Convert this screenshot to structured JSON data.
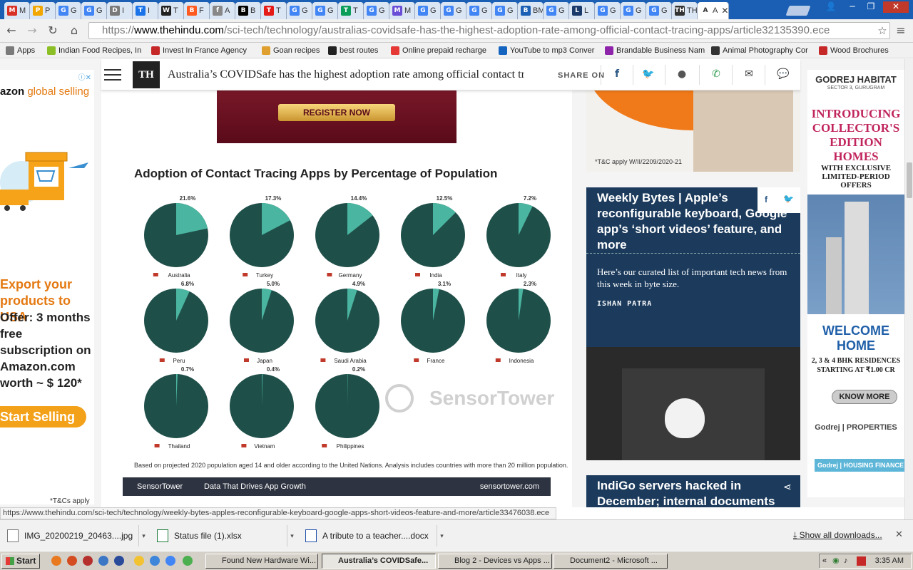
{
  "tabs": [
    {
      "fav": "M",
      "color": "#d93025",
      "title": "M"
    },
    {
      "fav": "P",
      "color": "#f2a600",
      "title": "P"
    },
    {
      "fav": "G",
      "color": "#4285f4",
      "title": "G"
    },
    {
      "fav": "G",
      "color": "#4285f4",
      "title": "G"
    },
    {
      "fav": "D",
      "color": "#7a7a7a",
      "title": "I"
    },
    {
      "fav": "T",
      "color": "#1a73e8",
      "title": "I"
    },
    {
      "fav": "W",
      "color": "#222222",
      "title": "T"
    },
    {
      "fav": "B",
      "color": "#ff5a1f",
      "title": "F"
    },
    {
      "fav": "f",
      "color": "#888888",
      "title": "A"
    },
    {
      "fav": "B",
      "color": "#000000",
      "title": "B"
    },
    {
      "fav": "T",
      "color": "#e41b17",
      "title": "T"
    },
    {
      "fav": "G",
      "color": "#4285f4",
      "title": "G"
    },
    {
      "fav": "G",
      "color": "#4285f4",
      "title": "G"
    },
    {
      "fav": "T",
      "color": "#0a9e5a",
      "title": "T"
    },
    {
      "fav": "G",
      "color": "#4285f4",
      "title": "G"
    },
    {
      "fav": "M",
      "color": "#6a4fd6",
      "title": "M"
    },
    {
      "fav": "G",
      "color": "#4285f4",
      "title": "G"
    },
    {
      "fav": "G",
      "color": "#4285f4",
      "title": "G"
    },
    {
      "fav": "G",
      "color": "#4285f4",
      "title": "G"
    },
    {
      "fav": "G",
      "color": "#4285f4",
      "title": "G"
    },
    {
      "fav": "B",
      "color": "#1a5fb4",
      "title": "BMJ"
    },
    {
      "fav": "G",
      "color": "#4285f4",
      "title": "G"
    },
    {
      "fav": "L",
      "color": "#1a3a6c",
      "title": "L"
    },
    {
      "fav": "G",
      "color": "#4285f4",
      "title": "G"
    },
    {
      "fav": "G",
      "color": "#4285f4",
      "title": "G"
    },
    {
      "fav": "G",
      "color": "#4285f4",
      "title": "G"
    },
    {
      "fav": "TH",
      "color": "#333333",
      "title": "TH"
    },
    {
      "fav": "A",
      "color": "#ffffff",
      "title": "A",
      "active": true
    }
  ],
  "url": {
    "scheme": "https://",
    "domain": "www.thehindu.com",
    "path": "/sci-tech/technology/australias-covidsafe-has-the-highest-adoption-rate-among-official-contact-tracing-apps/article32135390.ece"
  },
  "bookmarks": [
    {
      "label": "Apps",
      "color": "#7a7a7a"
    },
    {
      "label": "Indian Food Recipes, In",
      "color": "#8cbf26"
    },
    {
      "label": "Invest In France Agency",
      "color": "#c62828"
    },
    {
      "label": "Goan recipes",
      "color": "#e0a030"
    },
    {
      "label": "best routes",
      "color": "#222"
    },
    {
      "label": "Online prepaid recharge",
      "color": "#e53935"
    },
    {
      "label": "YouTube to mp3 Conver",
      "color": "#1565c0"
    },
    {
      "label": "Brandable Business Nam",
      "color": "#8e24aa"
    },
    {
      "label": "Animal Photography Cor",
      "color": "#333"
    },
    {
      "label": "Wood Brochures",
      "color": "#c62828"
    }
  ],
  "sticky": {
    "logo": "TH",
    "title": "Australia’s COVIDSafe has the highest adoption rate among official contact tracing apps",
    "share_label": "SHARE ON"
  },
  "left_ad": {
    "logo_prefix": "azon",
    "logo_suffix": "global selling",
    "headline": "Export your products to USA",
    "offer": "Offer: 3 months free subscription on Amazon.com worth ~ $ 120*",
    "cta": "Start Selling",
    "tnc": "*T&Cs apply"
  },
  "banner": {
    "button": "REGISTER NOW"
  },
  "chart_data": {
    "type": "pie",
    "title": "Adoption of Contact Tracing Apps by Percentage of Population",
    "categories": [
      "Australia",
      "Turkey",
      "Germany",
      "India",
      "Italy",
      "Peru",
      "Japan",
      "Saudi Arabia",
      "France",
      "Indonesia",
      "Thailand",
      "Vietnam",
      "Philippines"
    ],
    "values": [
      21.6,
      17.3,
      14.4,
      12.5,
      7.2,
      6.8,
      5.0,
      4.9,
      3.1,
      2.3,
      0.7,
      0.4,
      0.2
    ],
    "labels": [
      "21.6%",
      "17.3%",
      "14.4%",
      "12.5%",
      "7.2%",
      "6.8%",
      "5.0%",
      "4.9%",
      "3.1%",
      "2.3%",
      "0.7%",
      "0.4%",
      "0.2%"
    ],
    "colors": {
      "adopted": "#4ab5a0",
      "rest": "#1f4f49"
    },
    "watermark": "SensorTower",
    "footnote": "Based on projected 2020 population aged 14 and older according to the United Nations. Analysis includes countries with more than 20 million population."
  },
  "sensortower_bar": {
    "brand": "SensorTower",
    "tagline": "Data That Drives App Growth",
    "site": "sensortower.com"
  },
  "right_top_ad": {
    "tnc": "*T&C apply W/II/2209/2020-21"
  },
  "card1": {
    "title": "Weekly Bytes | Apple’s reconfigurable keyboard, Google app’s ‘short videos’ feature, and more",
    "desc": "Here’s our curated list of important tech news from this week in byte size.",
    "author": "ISHAN PATRA"
  },
  "card2": {
    "title": "IndiGo servers hacked in December; internal documents may get uploaded publicly"
  },
  "far_ad": {
    "brand": "GODREJ HABITAT",
    "location": "SECTOR 3, GURUGRAM",
    "headline": "INTRODUCING COLLECTOR'S EDITION HOMES",
    "sub": "WITH EXCLUSIVE LIMITED-PERIOD OFFERS",
    "welcome": "WELCOME HOME",
    "bhk": "2, 3 & 4 BHK RESIDENCES STARTING AT ₹1.00 CR",
    "cta": "KNOW MORE",
    "godrej1": "Godrej | PROPERTIES",
    "godrej2": "Godrej | HOUSING FINANCE"
  },
  "status_url": "https://www.thehindu.com/sci-tech/technology/weekly-bytes-apples-reconfigurable-keyboard-google-apps-short-videos-feature-and-more/article33476038.ece",
  "downloads": [
    {
      "name": "IMG_20200219_20463....jpg"
    },
    {
      "name": "Status file (1).xlsx"
    },
    {
      "name": "A tribute to a teacher....docx"
    }
  ],
  "show_all_downloads": "Show all downloads...",
  "taskbar": {
    "start": "Start",
    "items": [
      {
        "label": "Found New Hardware Wi...",
        "active": false
      },
      {
        "label": "Australia’s COVIDSafe...",
        "active": true
      },
      {
        "label": "Blog 2 - Devices vs Apps ...",
        "active": false
      },
      {
        "label": "Document2 - Microsoft ...",
        "active": false
      }
    ],
    "clock": "3:35 AM"
  }
}
